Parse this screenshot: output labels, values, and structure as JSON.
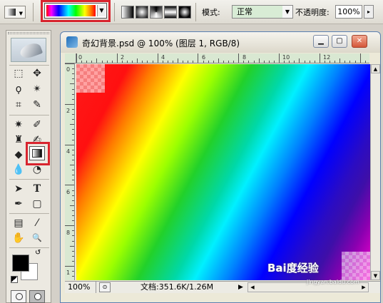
{
  "options_bar": {
    "tool_preset_arrow": "▼",
    "gradient_dropdown_arrow": "▼",
    "gradient_types": [
      "linear-gradient",
      "radial-gradient",
      "angle-gradient",
      "reflected-gradient",
      "diamond-gradient"
    ],
    "mode_label": "模式:",
    "mode_value": "正常",
    "mode_arrow": "▼",
    "opacity_label": "不透明度:",
    "opacity_value": "100%",
    "opacity_arrow": "▸",
    "highlight_color": "#d8242e"
  },
  "toolbox": {
    "tools": [
      {
        "name": "marquee-tool",
        "glyph": "⬚"
      },
      {
        "name": "move-tool",
        "glyph": "✥"
      },
      {
        "name": "lasso-tool",
        "glyph": "ϙ"
      },
      {
        "name": "magic-wand-tool",
        "glyph": "✴"
      },
      {
        "name": "crop-tool",
        "glyph": "⌗"
      },
      {
        "name": "slice-tool",
        "glyph": "✎"
      },
      {
        "name": "healing-brush-tool",
        "glyph": "✷"
      },
      {
        "name": "brush-tool",
        "glyph": "✐"
      },
      {
        "name": "clone-stamp-tool",
        "glyph": "♜"
      },
      {
        "name": "history-brush-tool",
        "glyph": "✍"
      },
      {
        "name": "eraser-tool",
        "glyph": "◆"
      },
      {
        "name": "gradient-tool",
        "glyph": ""
      },
      {
        "name": "blur-tool",
        "glyph": "💧"
      },
      {
        "name": "dodge-tool",
        "glyph": "◔"
      },
      {
        "name": "path-selection-tool",
        "glyph": "➤"
      },
      {
        "name": "type-tool",
        "glyph": "T"
      },
      {
        "name": "pen-tool",
        "glyph": "✒"
      },
      {
        "name": "shape-tool",
        "glyph": "▢"
      },
      {
        "name": "notes-tool",
        "glyph": "▤"
      },
      {
        "name": "eyedropper-tool",
        "glyph": "⁄"
      },
      {
        "name": "hand-tool",
        "glyph": "✋"
      },
      {
        "name": "zoom-tool",
        "glyph": "🔍"
      }
    ],
    "swap_glyph": "↺",
    "foreground_color": "#000000",
    "background_color": "#ffffff"
  },
  "document": {
    "title": "奇幻背景.psd @ 100% (图层 1, RGB/8)",
    "min_glyph": "▁",
    "max_glyph": "▢",
    "close_glyph": "✕",
    "ruler_h_labels": [
      "0",
      "2",
      "4",
      "6",
      "8",
      "10",
      "12"
    ],
    "ruler_v_labels": [
      "0",
      "2",
      "4",
      "6",
      "8",
      "1"
    ],
    "status": {
      "zoom": "100%",
      "doc_info": "文档:351.6K/1.26M",
      "arrow": "▶",
      "scroll_left": "◀",
      "scroll_right": "▶",
      "scroll_up": "▲",
      "scroll_down": "▼"
    },
    "watermark": "Bai度经验",
    "watermark_sub": "jingyan.baidu.com"
  }
}
